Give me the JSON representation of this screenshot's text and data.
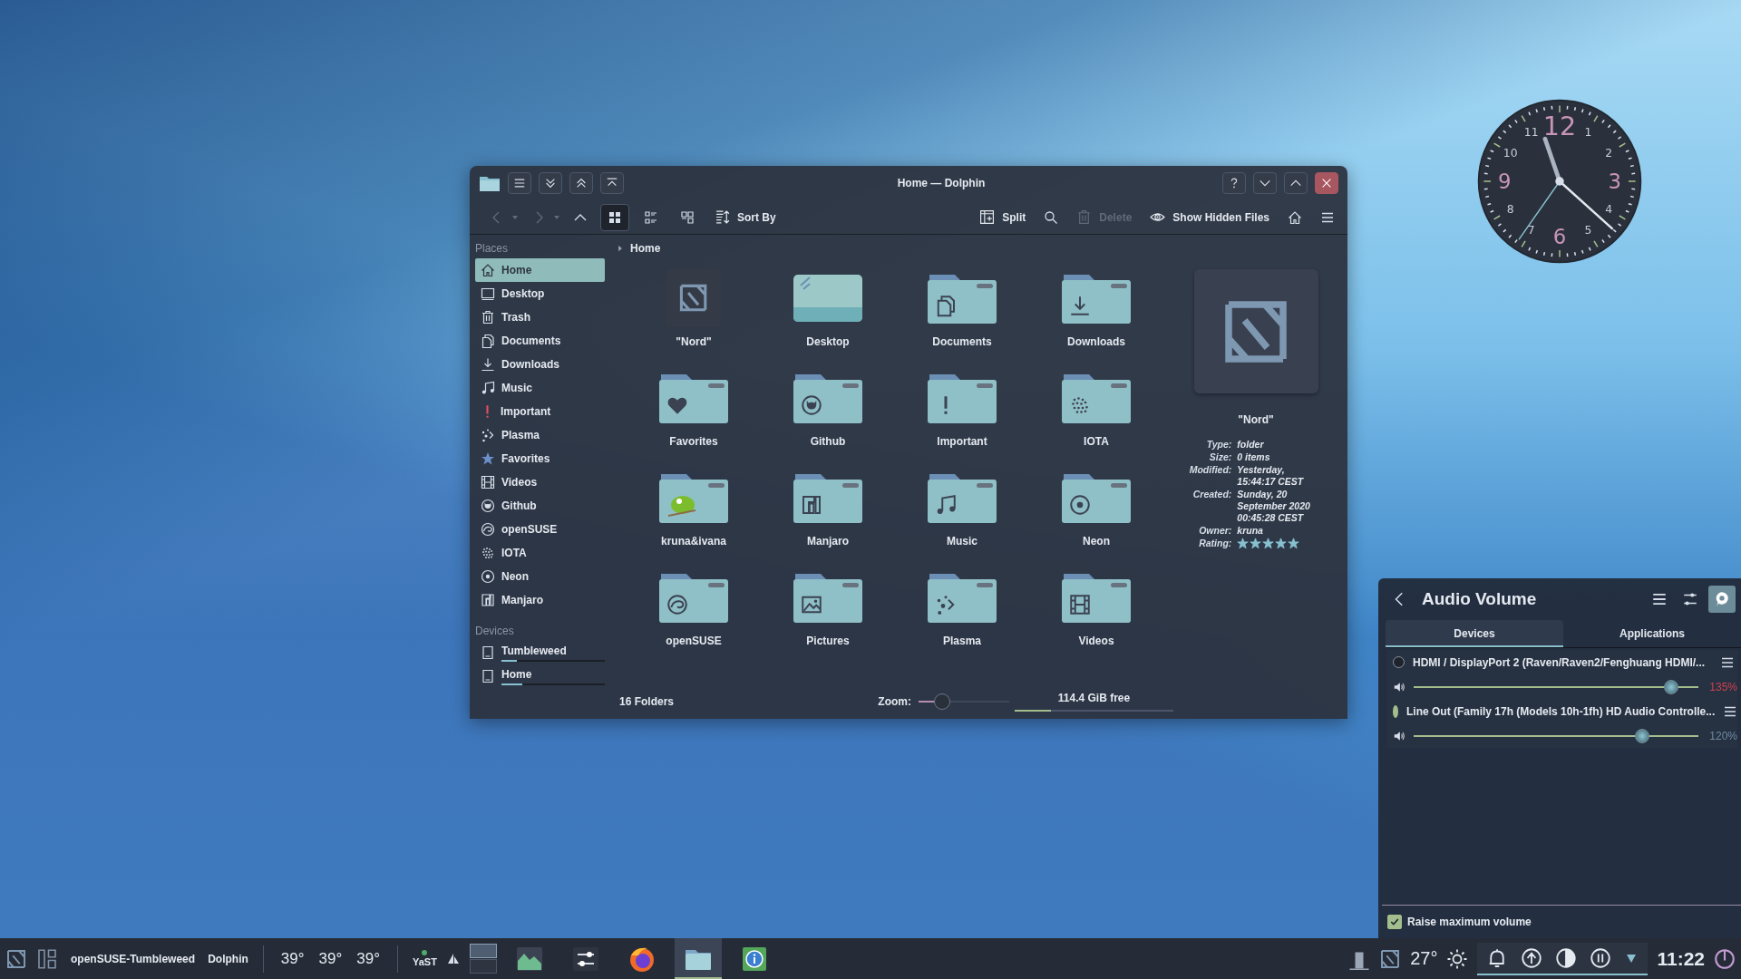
{
  "clock": {
    "numerals": [
      "11",
      "12",
      "1",
      "10",
      "2",
      "9",
      "3",
      "8",
      "4",
      "7",
      "6",
      "5"
    ]
  },
  "window": {
    "title": "Home — Dolphin"
  },
  "toolbar": {
    "view_modes": [
      {
        "selected": true
      },
      {
        "selected": false
      },
      {
        "selected": false
      }
    ],
    "sort_label": "Sort By",
    "split_label": "Split",
    "delete": {
      "label": "Delete",
      "disabled": true
    },
    "hidden_files_label": "Show Hidden Files"
  },
  "sidebar": {
    "places_title": "Places",
    "places": [
      {
        "label": "Home",
        "kind": "home",
        "selected": true
      },
      {
        "label": "Desktop",
        "kind": "desktop",
        "selected": false
      },
      {
        "label": "Trash",
        "kind": "trash",
        "selected": false
      },
      {
        "label": "Documents",
        "kind": "documents",
        "selected": false
      },
      {
        "label": "Downloads",
        "kind": "downloads",
        "selected": false
      },
      {
        "label": "Music",
        "kind": "music",
        "selected": false
      },
      {
        "label": "Important",
        "kind": "important",
        "selected": false
      },
      {
        "label": "Plasma",
        "kind": "plasma",
        "selected": false
      },
      {
        "label": "Favorites",
        "kind": "favorites",
        "selected": false
      },
      {
        "label": "Videos",
        "kind": "videos",
        "selected": false
      },
      {
        "label": "Github",
        "kind": "github",
        "selected": false
      },
      {
        "label": "openSUSE",
        "kind": "opensuse",
        "selected": false
      },
      {
        "label": "IOTA",
        "kind": "iota",
        "selected": false
      },
      {
        "label": "Neon",
        "kind": "neon",
        "selected": false
      },
      {
        "label": "Manjaro",
        "kind": "manjaro",
        "selected": false
      }
    ],
    "devices_title": "Devices",
    "devices": [
      {
        "label": "Tumbleweed",
        "level": 0.15
      },
      {
        "label": "Home",
        "level": 0.2
      }
    ]
  },
  "breadcrumb": "Home",
  "folders": [
    {
      "name": "\"Nord\"",
      "kind": "nord"
    },
    {
      "name": "Desktop",
      "kind": "desktop"
    },
    {
      "name": "Documents",
      "kind": "documents"
    },
    {
      "name": "Downloads",
      "kind": "downloads"
    },
    {
      "name": "Favorites",
      "kind": "favorites"
    },
    {
      "name": "Github",
      "kind": "github"
    },
    {
      "name": "Important",
      "kind": "important"
    },
    {
      "name": "IOTA",
      "kind": "iota"
    },
    {
      "name": "kruna&ivana",
      "kind": "photo"
    },
    {
      "name": "Manjaro",
      "kind": "manjaro"
    },
    {
      "name": "Music",
      "kind": "music"
    },
    {
      "name": "Neon",
      "kind": "neon"
    },
    {
      "name": "openSUSE",
      "kind": "opensuse"
    },
    {
      "name": "Pictures",
      "kind": "pictures"
    },
    {
      "name": "Plasma",
      "kind": "plasma"
    },
    {
      "name": "Videos",
      "kind": "videos"
    }
  ],
  "status_bar": {
    "count": "16 Folders",
    "zoom_label": "Zoom:",
    "zoom": {
      "level": 0.25
    },
    "free_space": {
      "label": "114.4 GiB free",
      "level": 0.23
    }
  },
  "info_panel": {
    "name": "\"Nord\"",
    "fields": [
      {
        "label": "Type:",
        "value": "folder"
      },
      {
        "label": "Size:",
        "value": "0 items"
      },
      {
        "label": "Modified:",
        "value": "Yesterday, 15:44:17 CEST"
      },
      {
        "label": "Created:",
        "value": "Sunday, 20 September 2020 00:45:28 CEST"
      },
      {
        "label": "Owner:",
        "value": "kruna"
      }
    ],
    "rating": {
      "label": "Rating:",
      "stars": 5
    }
  },
  "audio": {
    "title": "Audio Volume",
    "pinned": true,
    "tabs": [
      {
        "label": "Devices",
        "selected": true
      },
      {
        "label": "Applications",
        "selected": false
      }
    ],
    "devices": [
      {
        "name": "HDMI / DisplayPort 2 (Raven/Raven2/Fenghuang HDMI/...",
        "selected": false,
        "level": 0.9,
        "reading": "135%",
        "warning": true
      },
      {
        "name": "Line Out (Family 17h (Models 10h-1fh) HD Audio Controlle...",
        "selected": true,
        "level": 0.8,
        "reading": "120%",
        "warning": false
      }
    ],
    "raise_max": {
      "label": "Raise maximum volume",
      "checked": true
    }
  },
  "taskbar": {
    "window_titles": [
      "openSUSE-Tumbleweed",
      "Dolphin"
    ],
    "temperatures": [
      "39°",
      "39°",
      "39°"
    ],
    "yast_label": "YaST",
    "pager": [
      {
        "selected": true
      },
      {
        "selected": false
      }
    ],
    "launchers": [
      {
        "kind": "chart",
        "selected": false
      },
      {
        "kind": "mixer",
        "selected": false
      },
      {
        "kind": "firefox",
        "selected": false
      },
      {
        "kind": "files",
        "selected": true
      },
      {
        "kind": "info",
        "selected": false
      }
    ],
    "weather": "27°",
    "tray": [
      {
        "kind": "bell"
      },
      {
        "kind": "update"
      },
      {
        "kind": "disc"
      },
      {
        "kind": "pause"
      },
      {
        "kind": "expand"
      }
    ],
    "time": "11:22"
  }
}
